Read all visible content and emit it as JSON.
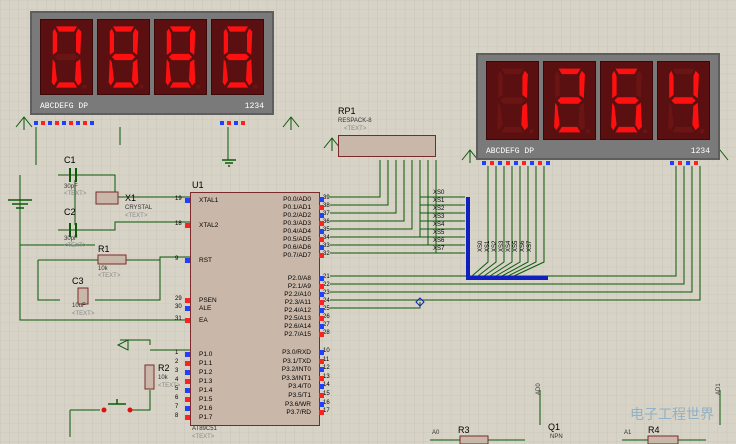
{
  "display_left": {
    "digits": [
      "0",
      "8",
      "8",
      "8"
    ],
    "segment_label": "ABCDEFG DP",
    "digit_label": "1234"
  },
  "display_right": {
    "digits": [
      "blank",
      "1",
      "2",
      "6",
      "4"
    ],
    "segment_label": "ABCDEFG DP",
    "digit_label": "1234"
  },
  "chip": {
    "ref": "U1",
    "name": "AT89C51",
    "placeholder": "<TEXT>",
    "left_pins": [
      {
        "num": "19",
        "name": "XTAL1"
      },
      {
        "num": "18",
        "name": "XTAL2"
      },
      {
        "num": "9",
        "name": "RST"
      },
      {
        "num": "29",
        "name": "PSEN"
      },
      {
        "num": "30",
        "name": "ALE"
      },
      {
        "num": "31",
        "name": "EA"
      },
      {
        "num": "1",
        "name": "P1.0"
      },
      {
        "num": "2",
        "name": "P1.1"
      },
      {
        "num": "3",
        "name": "P1.2"
      },
      {
        "num": "4",
        "name": "P1.3"
      },
      {
        "num": "5",
        "name": "P1.4"
      },
      {
        "num": "6",
        "name": "P1.5"
      },
      {
        "num": "7",
        "name": "P1.6"
      },
      {
        "num": "8",
        "name": "P1.7"
      }
    ],
    "right_pins": [
      {
        "num": "39",
        "name": "P0.0/AD0"
      },
      {
        "num": "38",
        "name": "P0.1/AD1"
      },
      {
        "num": "37",
        "name": "P0.2/AD2"
      },
      {
        "num": "36",
        "name": "P0.3/AD3"
      },
      {
        "num": "35",
        "name": "P0.4/AD4"
      },
      {
        "num": "34",
        "name": "P0.5/AD5"
      },
      {
        "num": "33",
        "name": "P0.6/AD6"
      },
      {
        "num": "32",
        "name": "P0.7/AD7"
      },
      {
        "num": "21",
        "name": "P2.0/A8"
      },
      {
        "num": "22",
        "name": "P2.1/A9"
      },
      {
        "num": "23",
        "name": "P2.2/A10"
      },
      {
        "num": "24",
        "name": "P2.3/A11"
      },
      {
        "num": "25",
        "name": "P2.4/A12"
      },
      {
        "num": "26",
        "name": "P2.5/A13"
      },
      {
        "num": "27",
        "name": "P2.6/A14"
      },
      {
        "num": "28",
        "name": "P2.7/A15"
      },
      {
        "num": "10",
        "name": "P3.0/RXD"
      },
      {
        "num": "11",
        "name": "P3.1/TXD"
      },
      {
        "num": "12",
        "name": "P3.2/INT0"
      },
      {
        "num": "13",
        "name": "P3.3/INT1"
      },
      {
        "num": "14",
        "name": "P3.4/T0"
      },
      {
        "num": "15",
        "name": "P3.5/T1"
      },
      {
        "num": "16",
        "name": "P3.6/WR"
      },
      {
        "num": "17",
        "name": "P3.7/RD"
      }
    ]
  },
  "bus_labels": [
    "XS0",
    "XS1",
    "XS2",
    "XS3",
    "XS4",
    "XS5",
    "XS6",
    "XS7"
  ],
  "bus_vertical_labels": [
    "XS0",
    "XS1",
    "XS2",
    "XS3",
    "XS4",
    "XS5",
    "XS6",
    "XS7"
  ],
  "components": {
    "c1": {
      "ref": "C1",
      "value": "30pF",
      "text": "<TEXT>"
    },
    "c2": {
      "ref": "C2",
      "value": "30pF",
      "text": "<TEXT>"
    },
    "c3": {
      "ref": "C3",
      "value": "10uF",
      "text": "<TEXT>"
    },
    "x1": {
      "ref": "X1",
      "value": "CRYSTAL",
      "text": "<TEXT>"
    },
    "r1": {
      "ref": "R1",
      "value": "10k",
      "text": "<TEXT>"
    },
    "r2": {
      "ref": "R2",
      "value": "10k",
      "text": "<TEXT>"
    },
    "rp1": {
      "ref": "RP1",
      "value": "RESPACK-8",
      "text": "<TEXT>"
    },
    "r3": {
      "ref": "R3"
    },
    "r4": {
      "ref": "R4"
    },
    "q1": {
      "ref": "Q1",
      "value": "NPN"
    },
    "a0": "A0",
    "a1": "A1",
    "ad0": "AD0",
    "ad1": "AD1"
  },
  "watermark": "电子工程世界",
  "colors": {
    "background": "#d7d3c7",
    "grid": "#c2beb2",
    "wire": "#0a5a0a",
    "bus": "#1020c0",
    "segment_on": "#ff1010",
    "segment_off": "#6a1414",
    "pin_red": "#ff2020",
    "pin_blue": "#2040ff"
  }
}
